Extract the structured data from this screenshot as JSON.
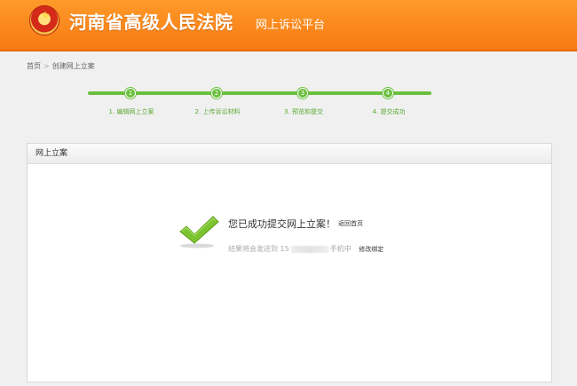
{
  "header": {
    "court_name": "河南省高级人民法院",
    "platform_name": "网上诉讼平台",
    "emblem_icon": "court-emblem-icon"
  },
  "breadcrumb": {
    "home": "首页",
    "separator": ">",
    "current": "创建网上立案"
  },
  "steps": [
    {
      "number": "1",
      "label": "1. 编辑网上立案"
    },
    {
      "number": "2",
      "label": "2. 上传诉讼材料"
    },
    {
      "number": "3",
      "label": "3. 预览和提交"
    },
    {
      "number": "4",
      "label": "4. 提交成功"
    }
  ],
  "panel": {
    "title": "网上立案",
    "success_message": "您已成功提交网上立案！",
    "back_home": "返回首页",
    "result_prefix": "结果将会发送到",
    "phone_prefix": "15",
    "result_suffix": "手机中",
    "modify_binding": "修改绑定"
  },
  "colors": {
    "header_orange": "#f7871c",
    "step_green": "#6bbf3e",
    "check_green": "#7cc42f"
  }
}
